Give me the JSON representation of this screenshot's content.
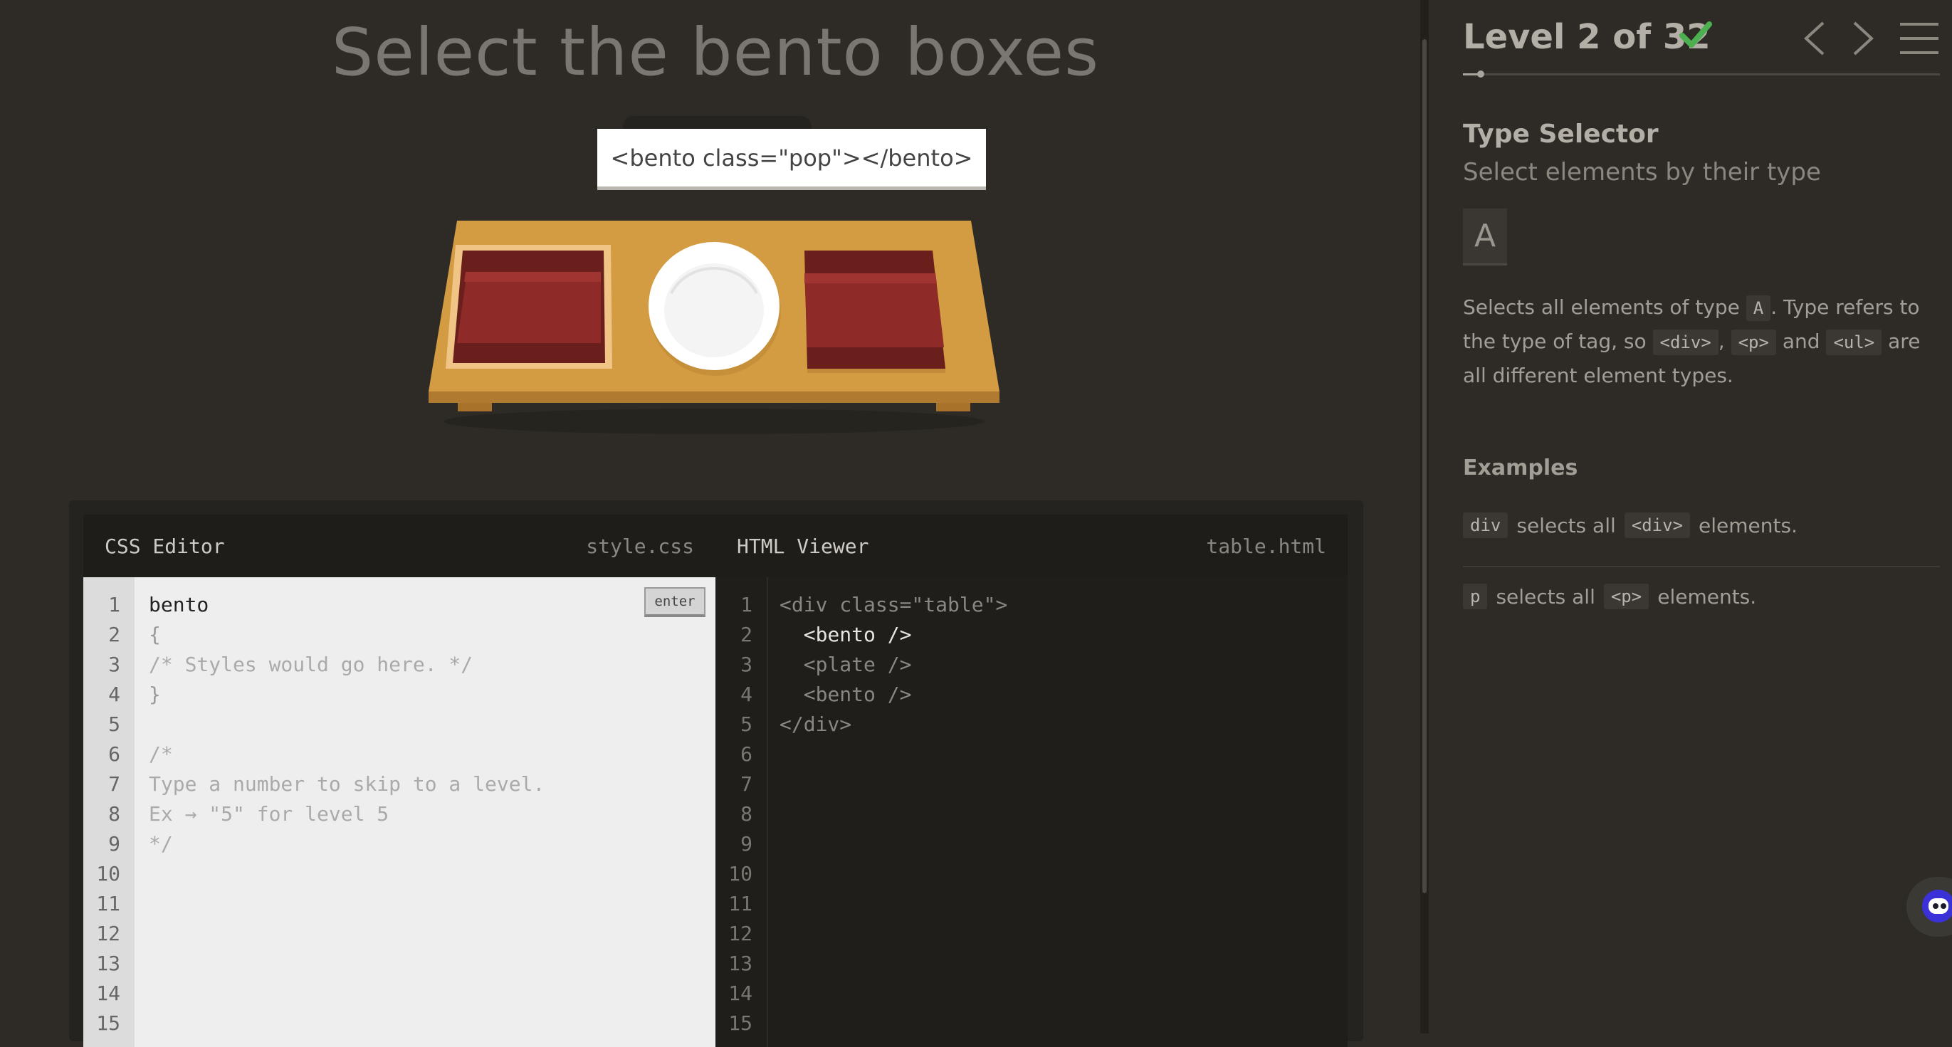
{
  "game": {
    "instruction": "Select the bento boxes",
    "tooltip": "<bento class=\"pop\"></bento>"
  },
  "css_editor": {
    "title": "CSS Editor",
    "filename": "style.css",
    "enter_label": "enter",
    "input_value": "bento",
    "lines": [
      "{",
      "/* Styles would go here. */",
      "}",
      "",
      "/*",
      "Type a number to skip to a level.",
      "Ex → \"5\" for level 5",
      "*/"
    ],
    "line_numbers": [
      "1",
      "2",
      "3",
      "4",
      "5",
      "6",
      "7",
      "8",
      "9",
      "10",
      "11",
      "12",
      "13",
      "14",
      "15"
    ]
  },
  "html_viewer": {
    "title": "HTML Viewer",
    "filename": "table.html",
    "lines": [
      "<div class=\"table\">",
      "  <bento />",
      "  <plate />",
      "  <bento />",
      "</div>"
    ],
    "line_numbers": [
      "1",
      "2",
      "3",
      "4",
      "5",
      "6",
      "7",
      "8",
      "9",
      "10",
      "11",
      "12",
      "13",
      "14",
      "15"
    ]
  },
  "sidebar": {
    "level_label": "Level 2 of 32",
    "progress_fraction": 0.0625,
    "selector_name": "Type Selector",
    "selector_subtitle": "Select elements by their type",
    "syntax": "A",
    "desc": {
      "p1": "Selects all elements of type ",
      "t1": "A",
      "p2": ". Type refers to the type of tag, so ",
      "t2": "<div>",
      "p3": ", ",
      "t3": "<p>",
      "p4": " and ",
      "t4": "<ul>",
      "p5": " are all different element types."
    },
    "examples_heading": "Examples",
    "examples": [
      {
        "code": "div",
        "text1": "selects all",
        "tag": "<div>",
        "text2": "elements."
      },
      {
        "code": "p",
        "text1": "selects all",
        "tag": "<p>",
        "text2": "elements."
      }
    ]
  },
  "colors": {
    "background": "#2e2b26",
    "table_wood": "#d39c42",
    "bento_red": "#8e2a27",
    "check_green": "#4caf50"
  }
}
